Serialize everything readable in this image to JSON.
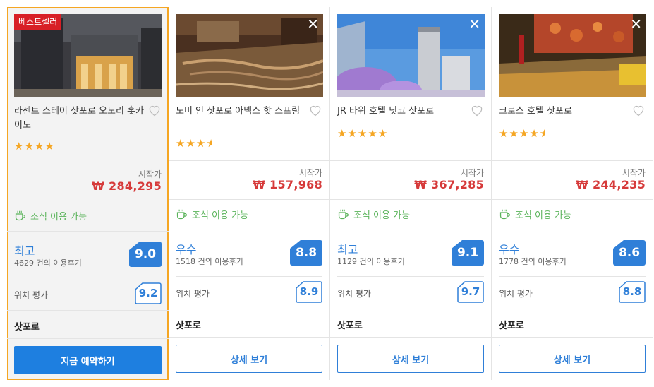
{
  "hotels": [
    {
      "badge": "베스트셀러",
      "name": "라젠트 스테이 삿포로 오도리 홋카이도",
      "stars": "★★★★",
      "price_from": "시작가",
      "price": "₩ 284,295",
      "breakfast": "조식 이용 가능",
      "rating_word": "최고",
      "reviews": "4629 건의 이용후기",
      "score": "9.0",
      "location_label": "위치 평가",
      "location_score": "9.2",
      "city": "삿포로",
      "button": "지금 예약하기"
    },
    {
      "close": "✕",
      "name": "도미 인 삿포로 아넥스 핫 스프링",
      "stars": "★★★",
      "price_from": "시작가",
      "price": "₩ 157,968",
      "breakfast": "조식 이용 가능",
      "rating_word": "우수",
      "reviews": "1518 건의 이용후기",
      "score": "8.8",
      "location_label": "위치 평가",
      "location_score": "8.9",
      "city": "삿포로",
      "button": "상세 보기"
    },
    {
      "close": "✕",
      "name": "JR 타워 호텔 닛코 삿포로",
      "stars": "★★★★★",
      "price_from": "시작가",
      "price": "₩ 367,285",
      "breakfast": "조식 이용 가능",
      "rating_word": "최고",
      "reviews": "1129 건의 이용후기",
      "score": "9.1",
      "location_label": "위치 평가",
      "location_score": "9.7",
      "city": "삿포로",
      "button": "상세 보기"
    },
    {
      "close": "✕",
      "name": "크로스 호텔 삿포로",
      "stars": "★★★★",
      "price_from": "시작가",
      "price": "₩ 244,235",
      "breakfast": "조식 이용 가능",
      "rating_word": "우수",
      "reviews": "1778 건의 이용후기",
      "score": "8.6",
      "location_label": "위치 평가",
      "location_score": "8.8",
      "city": "삿포로",
      "button": "상세 보기"
    }
  ],
  "star_ratings": [
    4,
    3.5,
    5,
    4.5
  ],
  "colors": {
    "accent_blue": "#2f7fd8",
    "price_red": "#d63a3a",
    "star_orange": "#f5a623",
    "breakfast_green": "#5ab35a",
    "badge_red": "#d81f26",
    "highlight_border": "#f5a623"
  },
  "icons": [
    "heart-icon",
    "coffee-cup-icon",
    "close-icon",
    "star-icon"
  ]
}
